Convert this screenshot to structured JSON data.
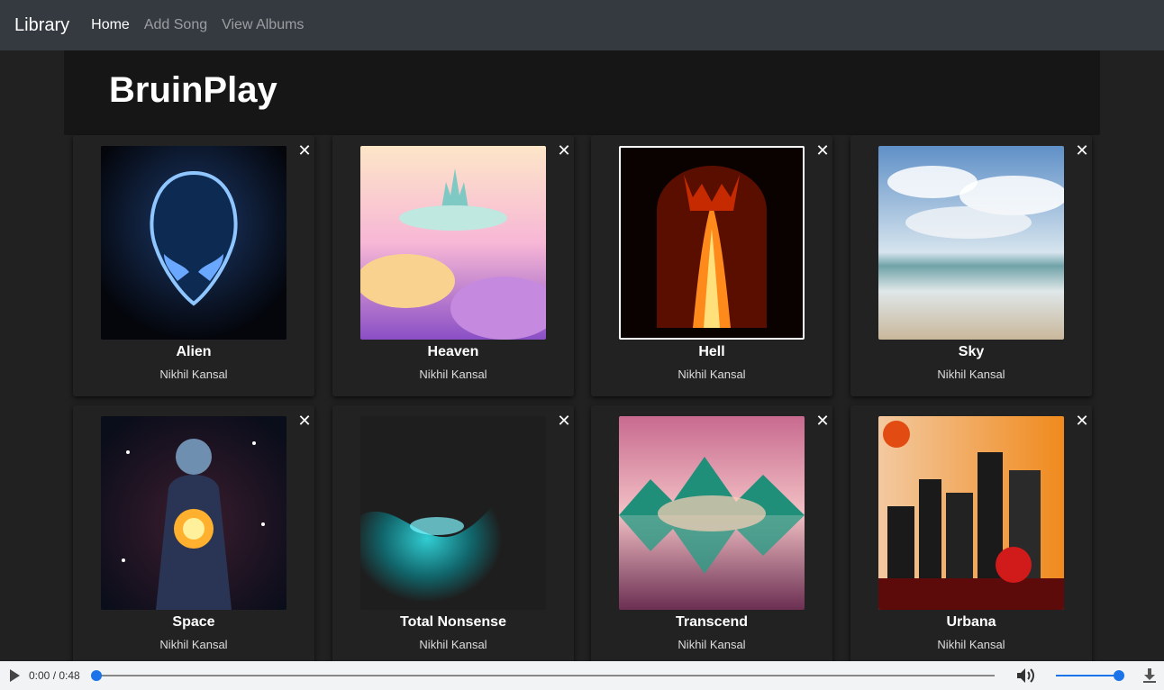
{
  "navbar": {
    "brand": "Library",
    "links": [
      {
        "label": "Home",
        "active": true
      },
      {
        "label": "Add Song",
        "active": false
      },
      {
        "label": "View Albums",
        "active": false
      }
    ]
  },
  "page": {
    "title": "BruinPlay"
  },
  "close_glyph": "✕",
  "songs": [
    {
      "title": "Alien",
      "artist": "Nikhil Kansal",
      "art": "alien-art"
    },
    {
      "title": "Heaven",
      "artist": "Nikhil Kansal",
      "art": "heaven-art"
    },
    {
      "title": "Hell",
      "artist": "Nikhil Kansal",
      "art": "hell-art",
      "selected": true
    },
    {
      "title": "Sky",
      "artist": "Nikhil Kansal",
      "art": "sky-art"
    },
    {
      "title": "Space",
      "artist": "Nikhil Kansal",
      "art": "space-art"
    },
    {
      "title": "Total Nonsense",
      "artist": "Nikhil Kansal",
      "art": "total-nonsense-art"
    },
    {
      "title": "Transcend",
      "artist": "Nikhil Kansal",
      "art": "transcend-art"
    },
    {
      "title": "Urbana",
      "artist": "Nikhil Kansal",
      "art": "urbana-art"
    }
  ],
  "player": {
    "time": "0:00 / 0:48",
    "progress": 0,
    "volume": 1.0,
    "play_icon": "play-icon",
    "volume_icon": "volume-icon",
    "download_icon": "download-icon",
    "accent": "#1a73e8"
  }
}
